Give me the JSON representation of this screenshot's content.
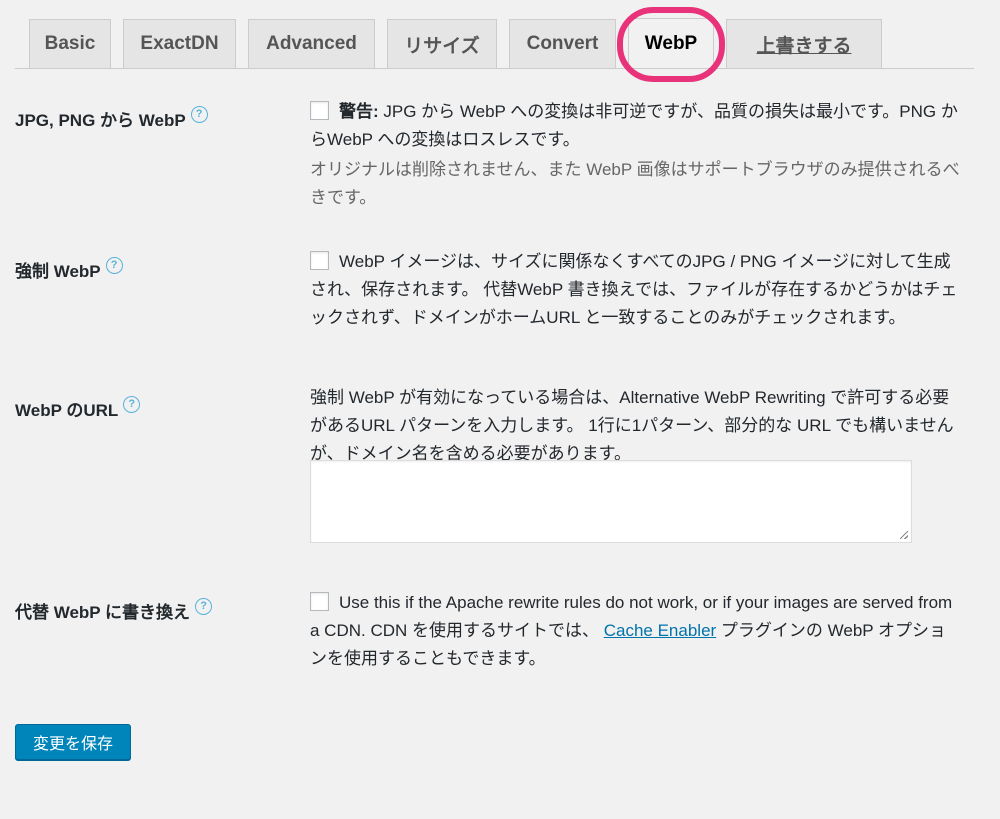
{
  "tabs": [
    {
      "label": "Basic",
      "active": false
    },
    {
      "label": "ExactDN",
      "active": false
    },
    {
      "label": "Advanced",
      "active": false
    },
    {
      "label": "リサイズ",
      "active": false
    },
    {
      "label": "Convert",
      "active": false
    },
    {
      "label": "WebP",
      "active": true
    },
    {
      "label": "上書きする",
      "active": false
    }
  ],
  "highlight_color": "#e8337a",
  "rows": {
    "jpg_png_webp": {
      "label": "JPG, PNG から WebP",
      "checked": false,
      "warning_prefix": "警告:",
      "warning_text": " JPG から WebP への変換は非可逆ですが、品質の損失は最小です。PNG からWebP への変換はロスレスです。",
      "note": "オリジナルは削除されません、また WebP 画像はサポートブラウザのみ提供されるべきです。"
    },
    "force_webp": {
      "label": "強制 WebP",
      "checked": false,
      "text": "WebP イメージは、サイズに関係なくすべてのJPG / PNG イメージに対して生成され、保存されます。 代替WebP 書き換えでは、ファイルが存在するかどうかはチェックされず、ドメインがホームURL と一致することのみがチェックされます。"
    },
    "webp_url": {
      "label": "WebP のURL",
      "text": "強制 WebP が有効になっている場合は、Alternative WebP Rewriting で許可する必要があるURL パターンを入力します。 1行に1パターン、部分的な URL でも構いませんが、ドメイン名を含める必要があります。",
      "textarea_value": ""
    },
    "alt_webp": {
      "label": "代替 WebP に書き換え",
      "checked": false,
      "text_before": "Use this if the Apache rewrite rules do not work, or if your images are served from a CDN. CDN を使用するサイトでは、 ",
      "link_text": "Cache Enabler",
      "text_after": " プラグインの WebP オプションを使用することもできます。"
    }
  },
  "help_icon": "?",
  "save_button": "変更を保存",
  "colors": {
    "accent": "#0085ba",
    "link": "#0073aa",
    "help": "#58b2dc",
    "background": "#f1f1f1"
  }
}
